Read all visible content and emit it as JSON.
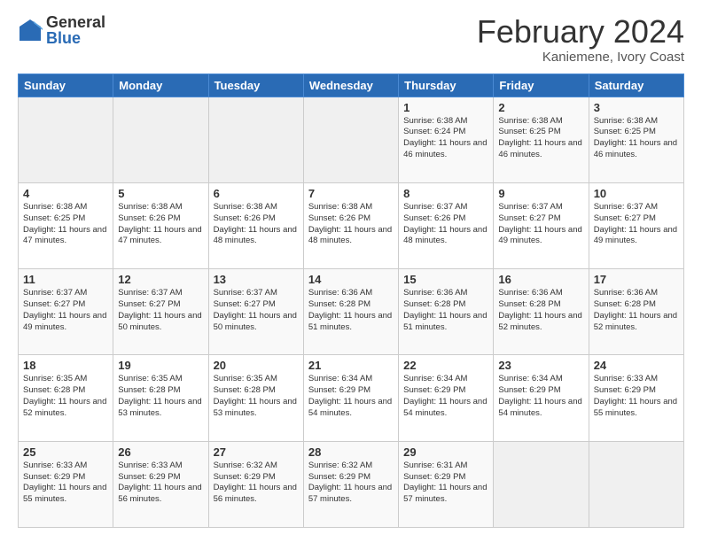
{
  "logo": {
    "general": "General",
    "blue": "Blue"
  },
  "title": {
    "month_year": "February 2024",
    "location": "Kaniemene, Ivory Coast"
  },
  "headers": [
    "Sunday",
    "Monday",
    "Tuesday",
    "Wednesday",
    "Thursday",
    "Friday",
    "Saturday"
  ],
  "weeks": [
    [
      {
        "day": "",
        "info": ""
      },
      {
        "day": "",
        "info": ""
      },
      {
        "day": "",
        "info": ""
      },
      {
        "day": "",
        "info": ""
      },
      {
        "day": "1",
        "info": "Sunrise: 6:38 AM\nSunset: 6:24 PM\nDaylight: 11 hours\nand 46 minutes."
      },
      {
        "day": "2",
        "info": "Sunrise: 6:38 AM\nSunset: 6:25 PM\nDaylight: 11 hours\nand 46 minutes."
      },
      {
        "day": "3",
        "info": "Sunrise: 6:38 AM\nSunset: 6:25 PM\nDaylight: 11 hours\nand 46 minutes."
      }
    ],
    [
      {
        "day": "4",
        "info": "Sunrise: 6:38 AM\nSunset: 6:25 PM\nDaylight: 11 hours\nand 47 minutes."
      },
      {
        "day": "5",
        "info": "Sunrise: 6:38 AM\nSunset: 6:26 PM\nDaylight: 11 hours\nand 47 minutes."
      },
      {
        "day": "6",
        "info": "Sunrise: 6:38 AM\nSunset: 6:26 PM\nDaylight: 11 hours\nand 48 minutes."
      },
      {
        "day": "7",
        "info": "Sunrise: 6:38 AM\nSunset: 6:26 PM\nDaylight: 11 hours\nand 48 minutes."
      },
      {
        "day": "8",
        "info": "Sunrise: 6:37 AM\nSunset: 6:26 PM\nDaylight: 11 hours\nand 48 minutes."
      },
      {
        "day": "9",
        "info": "Sunrise: 6:37 AM\nSunset: 6:27 PM\nDaylight: 11 hours\nand 49 minutes."
      },
      {
        "day": "10",
        "info": "Sunrise: 6:37 AM\nSunset: 6:27 PM\nDaylight: 11 hours\nand 49 minutes."
      }
    ],
    [
      {
        "day": "11",
        "info": "Sunrise: 6:37 AM\nSunset: 6:27 PM\nDaylight: 11 hours\nand 49 minutes."
      },
      {
        "day": "12",
        "info": "Sunrise: 6:37 AM\nSunset: 6:27 PM\nDaylight: 11 hours\nand 50 minutes."
      },
      {
        "day": "13",
        "info": "Sunrise: 6:37 AM\nSunset: 6:27 PM\nDaylight: 11 hours\nand 50 minutes."
      },
      {
        "day": "14",
        "info": "Sunrise: 6:36 AM\nSunset: 6:28 PM\nDaylight: 11 hours\nand 51 minutes."
      },
      {
        "day": "15",
        "info": "Sunrise: 6:36 AM\nSunset: 6:28 PM\nDaylight: 11 hours\nand 51 minutes."
      },
      {
        "day": "16",
        "info": "Sunrise: 6:36 AM\nSunset: 6:28 PM\nDaylight: 11 hours\nand 52 minutes."
      },
      {
        "day": "17",
        "info": "Sunrise: 6:36 AM\nSunset: 6:28 PM\nDaylight: 11 hours\nand 52 minutes."
      }
    ],
    [
      {
        "day": "18",
        "info": "Sunrise: 6:35 AM\nSunset: 6:28 PM\nDaylight: 11 hours\nand 52 minutes."
      },
      {
        "day": "19",
        "info": "Sunrise: 6:35 AM\nSunset: 6:28 PM\nDaylight: 11 hours\nand 53 minutes."
      },
      {
        "day": "20",
        "info": "Sunrise: 6:35 AM\nSunset: 6:28 PM\nDaylight: 11 hours\nand 53 minutes."
      },
      {
        "day": "21",
        "info": "Sunrise: 6:34 AM\nSunset: 6:29 PM\nDaylight: 11 hours\nand 54 minutes."
      },
      {
        "day": "22",
        "info": "Sunrise: 6:34 AM\nSunset: 6:29 PM\nDaylight: 11 hours\nand 54 minutes."
      },
      {
        "day": "23",
        "info": "Sunrise: 6:34 AM\nSunset: 6:29 PM\nDaylight: 11 hours\nand 54 minutes."
      },
      {
        "day": "24",
        "info": "Sunrise: 6:33 AM\nSunset: 6:29 PM\nDaylight: 11 hours\nand 55 minutes."
      }
    ],
    [
      {
        "day": "25",
        "info": "Sunrise: 6:33 AM\nSunset: 6:29 PM\nDaylight: 11 hours\nand 55 minutes."
      },
      {
        "day": "26",
        "info": "Sunrise: 6:33 AM\nSunset: 6:29 PM\nDaylight: 11 hours\nand 56 minutes."
      },
      {
        "day": "27",
        "info": "Sunrise: 6:32 AM\nSunset: 6:29 PM\nDaylight: 11 hours\nand 56 minutes."
      },
      {
        "day": "28",
        "info": "Sunrise: 6:32 AM\nSunset: 6:29 PM\nDaylight: 11 hours\nand 57 minutes."
      },
      {
        "day": "29",
        "info": "Sunrise: 6:31 AM\nSunset: 6:29 PM\nDaylight: 11 hours\nand 57 minutes."
      },
      {
        "day": "",
        "info": ""
      },
      {
        "day": "",
        "info": ""
      }
    ]
  ]
}
